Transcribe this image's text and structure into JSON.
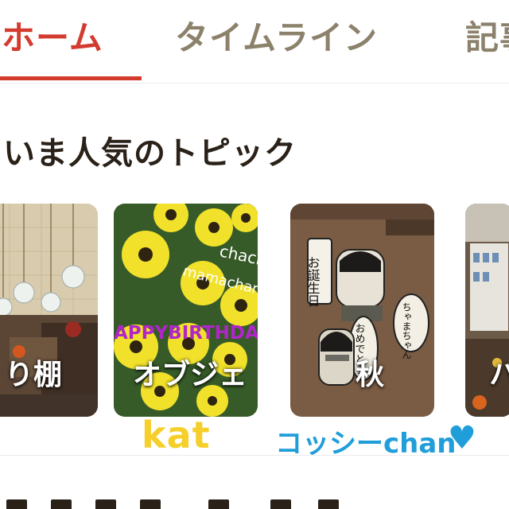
{
  "tabs": {
    "home": "ホーム",
    "timeline": "タイムライン",
    "articles": "記事"
  },
  "active_tab": "home",
  "colors": {
    "accent": "#d43b2f",
    "tab_inactive": "#8c826c",
    "title": "#2a2118"
  },
  "section": {
    "title": "いま人気のトピック"
  },
  "topics": [
    {
      "label": "り棚"
    },
    {
      "label": "オブジェ",
      "overlay_lines": [
        "chacha",
        "mamachan",
        "APPYBIRTHDA"
      ]
    },
    {
      "label": "秋",
      "overlay_lines": [
        "お誕生日",
        "ちゃまちゃん",
        "おめでとう"
      ]
    },
    {
      "label": "ハ"
    }
  ],
  "watermarks": {
    "kat": "kat",
    "kossy": "コッシーchan",
    "heart": "♥"
  }
}
